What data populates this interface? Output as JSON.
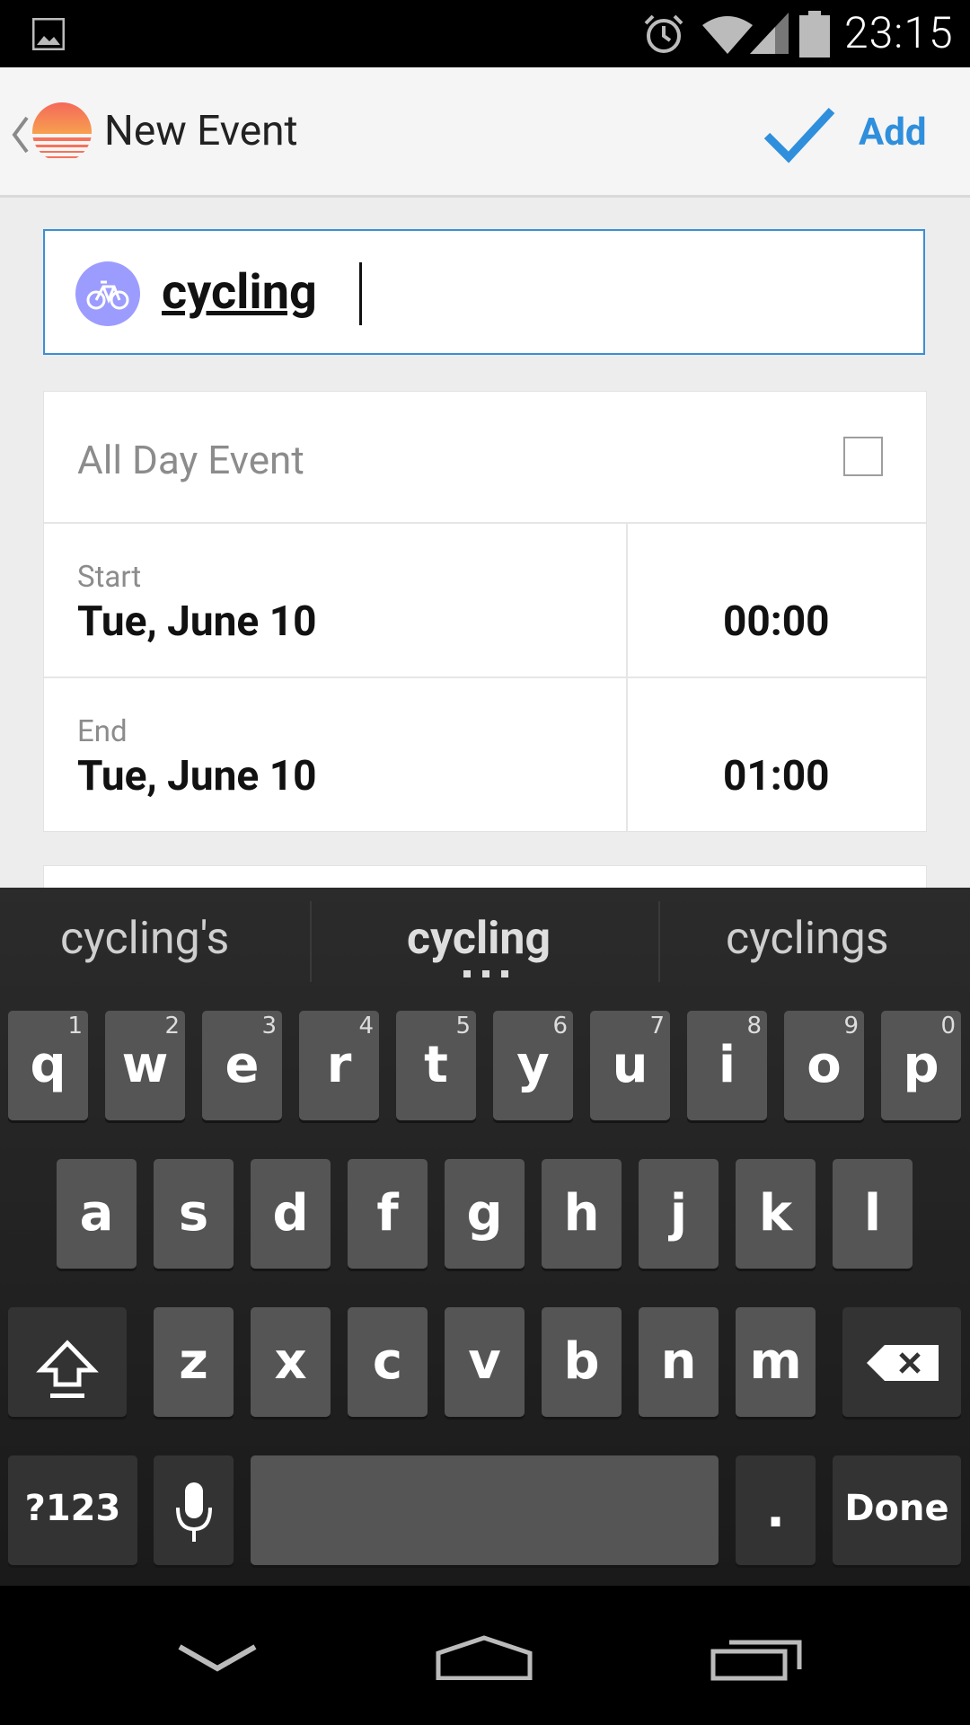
{
  "status_bar": {
    "time": "23:15"
  },
  "action_bar": {
    "title": "New Event",
    "add_label": "Add"
  },
  "event": {
    "title_value": "cycling",
    "all_day_label": "All Day Event",
    "all_day_checked": false,
    "start": {
      "label": "Start",
      "date": "Tue, June 10",
      "time": "00:00"
    },
    "end": {
      "label": "End",
      "date": "Tue, June 10",
      "time": "01:00"
    }
  },
  "keyboard": {
    "suggestions": [
      "cycling's",
      "cycling",
      "cyclings"
    ],
    "row1": [
      {
        "key": "q",
        "hint": "1"
      },
      {
        "key": "w",
        "hint": "2"
      },
      {
        "key": "e",
        "hint": "3"
      },
      {
        "key": "r",
        "hint": "4"
      },
      {
        "key": "t",
        "hint": "5"
      },
      {
        "key": "y",
        "hint": "6"
      },
      {
        "key": "u",
        "hint": "7"
      },
      {
        "key": "i",
        "hint": "8"
      },
      {
        "key": "o",
        "hint": "9"
      },
      {
        "key": "p",
        "hint": "0"
      }
    ],
    "row2": [
      "a",
      "s",
      "d",
      "f",
      "g",
      "h",
      "j",
      "k",
      "l"
    ],
    "row3": [
      "z",
      "x",
      "c",
      "v",
      "b",
      "n",
      "m"
    ],
    "symbols_label": "?123",
    "period_label": ".",
    "done_label": "Done"
  },
  "colors": {
    "accent": "#2f8fdc",
    "badge": "#9c9cff",
    "logo_top": "#f4675a",
    "logo_bottom": "#f58b5d"
  }
}
